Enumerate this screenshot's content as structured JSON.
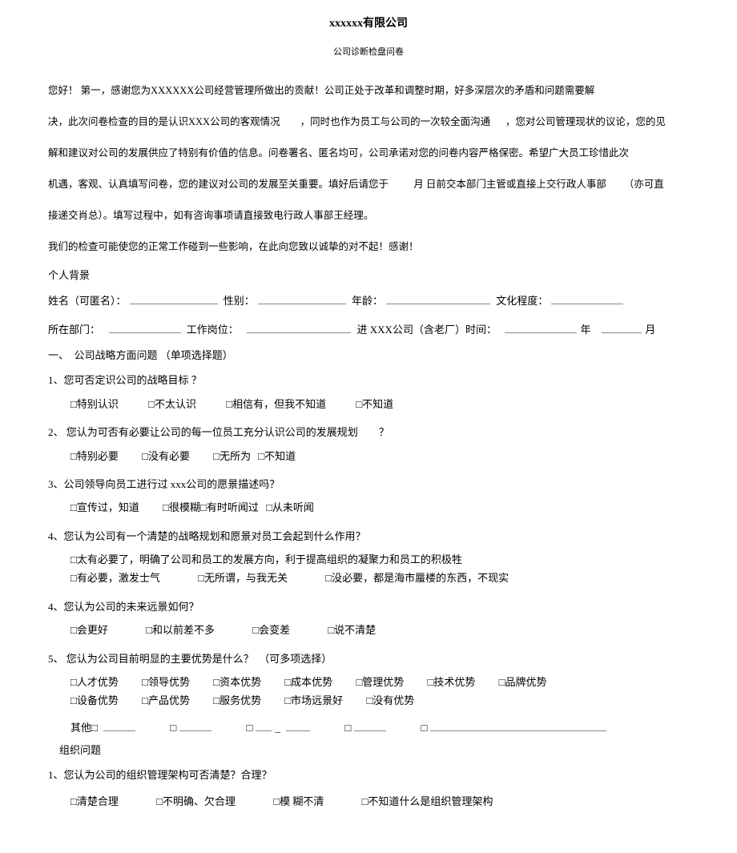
{
  "header": {
    "title": "xxxxxx有限公司",
    "subtitle": "公司诊断检盘问卷"
  },
  "intro": {
    "p1": "您好！ 第一，感谢您为XXXXXX公司经营管理所做出的贡献！公司正处于改革和调整时期，好多深层次的矛盾和问题需要解",
    "p2a": "决，此次问卷检查的目的是认识XXX公司的客观情况",
    "p2b": "，同时也作为员工与公司的一次较全面沟通",
    "p2c": "，您对公司管理现状的议论，您的见",
    "p3": "解和建议对公司的发展供应了特别有价值的信息。问卷署名、匿名均可，公司承诺对您的问卷内容严格保密。希望广大员工珍惜此次",
    "p4a": "机遇，客观、认真填写问卷，您的建议对公司的发展至关重要。填好后请您于",
    "p4b": "月 日前交本部门主管或直接上交行政人事部",
    "p4c": "（亦可直",
    "p5": "接递交肖总）。填写过程中，如有咨询事项请直接致电行政人事部王经理。",
    "p6": "我们的检查可能使您的正常工作碰到一些影响，在此向您致以诚挚的对不起！感谢！"
  },
  "background": {
    "heading": "个人背景",
    "name_label": "姓名（可匿名）：",
    "gender_label": "性别：",
    "age_label": "年龄：",
    "edu_label": "文化程度：",
    "dept_label": "所在部门：",
    "post_label": "工作岗位：",
    "join_label_a": "进 XXX公司（含老厂）时间：",
    "join_year": "年",
    "join_month": "月"
  },
  "section1": {
    "heading": "一、　公司战略方面问题 （单项选择题）",
    "q1": {
      "text": "1、您可否定识公司的战略目标 ？",
      "opts": [
        "□特别认识",
        "□不太认识",
        "□相信有，但我不知道",
        "□不知道"
      ]
    },
    "q2": {
      "text": "2、 您认为可否有必要让公司的每一位员工充分认识公司的发展规划　　？",
      "opts": [
        "□特别必要",
        "□没有必要",
        "□无所为",
        "□不知道"
      ]
    },
    "q3": {
      "text": "3、公司领导向员工进行过 xxx公司的愿景描述吗？",
      "opts": [
        "□宣传过，知道",
        "□很模糊□有时听闻过",
        "□从未听闻"
      ]
    },
    "q4": {
      "text": "4、您认为公司有一个清楚的战略规划和愿景对员工会起到什么作用？",
      "opts_line1": [
        "□太有必要了，明确了公司和员工的发展方向，利于提高组织的凝聚力和员工的积极牲"
      ],
      "opts_line2": [
        "□有必要，激发士气",
        "□无所谓，与我无关",
        "□没必要，都是海市蜃楼的东西，不现实"
      ]
    },
    "q4b": {
      "text": "4、您认为公司的未来远景如何？",
      "opts": [
        "□会更好",
        "□和以前差不多",
        "□会变差",
        "□说不清楚"
      ]
    },
    "q5": {
      "text": "5、 您认为公司目前明显的主要优势是什么？　（可多项选择）",
      "opts_line1": [
        "□人才优势",
        "□领导优势",
        "□资本优势",
        "□成本优势",
        "□管理优势",
        "□技术优势",
        "□品牌优势"
      ],
      "opts_line2": [
        "□设备优势",
        "□产品优势",
        "□服务优势",
        "□市场远景好",
        "□没有优势"
      ],
      "other_label": "其他□"
    }
  },
  "section2": {
    "heading": "组织问题",
    "q1": {
      "text": "1、您认为公司的组织管理架构可否清楚？合理？",
      "opts": [
        "□清楚合理",
        "□不明确、欠合理",
        "□模 糊不清",
        "□不知道什么是组织管理架构"
      ]
    }
  }
}
